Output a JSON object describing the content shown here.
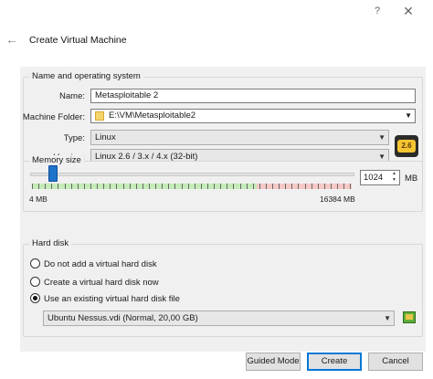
{
  "window": {
    "title": "Create Virtual Machine",
    "help_icon": "?",
    "close_icon": "✕",
    "back_icon": "←"
  },
  "name_os": {
    "section_label": "Name and operating system",
    "name_label": "Name:",
    "name_value": "Metasploitable 2",
    "folder_label": "Machine Folder:",
    "folder_value": "E:\\VM\\Metasploitable2",
    "type_label": "Type:",
    "type_value": "Linux",
    "version_label": "Version:",
    "version_value": "Linux 2.6 / 3.x / 4.x (32-bit)",
    "os_badge": "2.6"
  },
  "memory": {
    "section_label": "Memory size",
    "value": "1024",
    "unit": "MB",
    "min_label": "4 MB",
    "max_label": "16384 MB",
    "selected_fraction": 0.0625
  },
  "hard_disk": {
    "section_label": "Hard disk",
    "options": [
      {
        "label": "Do not add a virtual hard disk",
        "checked": false
      },
      {
        "label": "Create a virtual hard disk now",
        "checked": false
      },
      {
        "label": "Use an existing virtual hard disk file",
        "checked": true
      }
    ],
    "file_value": "Ubuntu Nessus.vdi (Normal, 20,00 GB)"
  },
  "buttons": {
    "guided_mode": "Guided Mode",
    "create": "Create",
    "cancel": "Cancel"
  }
}
